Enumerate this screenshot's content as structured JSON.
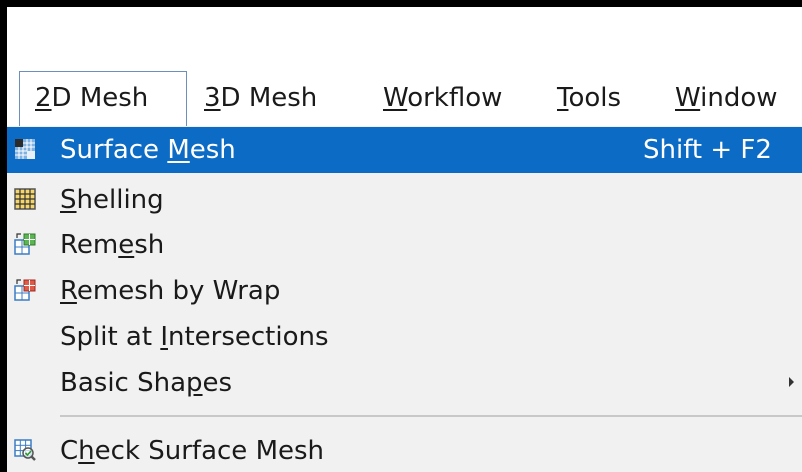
{
  "menubar": {
    "items": [
      {
        "before": "",
        "key": "2",
        "after": "D Mesh"
      },
      {
        "before": "",
        "key": "3",
        "after": "D Mesh"
      },
      {
        "before": "",
        "key": "W",
        "after": "orkflow"
      },
      {
        "before": "",
        "key": "T",
        "after": "ools"
      },
      {
        "before": "",
        "key": "W",
        "after": "indow"
      }
    ],
    "active_index": 0
  },
  "menu": {
    "items": [
      {
        "icon": "surface-mesh-icon",
        "before": "Surface ",
        "key": "M",
        "after": "esh",
        "shortcut": "Shift + F2",
        "highlighted": true
      },
      {
        "icon": "shelling-icon",
        "before": "",
        "key": "S",
        "after": "helling"
      },
      {
        "icon": "remesh-icon",
        "before": "Rem",
        "key": "e",
        "after": "sh"
      },
      {
        "icon": "remesh-by-wrap-icon",
        "before": "",
        "key": "R",
        "after": "emesh by Wrap"
      },
      {
        "icon": "",
        "before": "Split at ",
        "key": "I",
        "after": "ntersections"
      },
      {
        "icon": "",
        "before": "Basic Sha",
        "key": "p",
        "after": "es",
        "submenu": true
      },
      {
        "icon": "check-surface-mesh-icon",
        "before": "C",
        "key": "h",
        "after": "eck Surface Mesh"
      }
    ]
  },
  "colors": {
    "highlight": "#0c6bc4",
    "menu_background": "#f1f1f1",
    "active_border": "#6c90bd"
  }
}
